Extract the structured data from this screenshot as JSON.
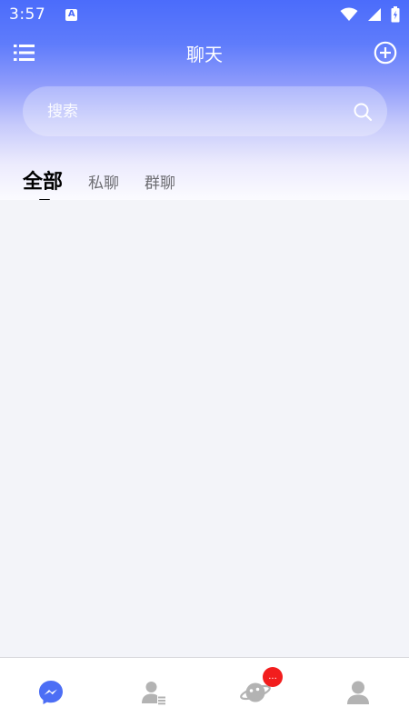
{
  "status_bar": {
    "time": "3:57",
    "app_icon_letter": "A"
  },
  "header": {
    "title": "聊天"
  },
  "search": {
    "placeholder": "搜索"
  },
  "tabs": [
    {
      "label": "全部",
      "active": true
    },
    {
      "label": "私聊",
      "active": false
    },
    {
      "label": "群聊",
      "active": false
    }
  ],
  "bottom_nav": {
    "items": [
      {
        "icon": "messenger-icon",
        "active": true
      },
      {
        "icon": "contacts-icon",
        "active": false
      },
      {
        "icon": "planet-icon",
        "active": false,
        "badge": "..."
      },
      {
        "icon": "profile-icon",
        "active": false
      }
    ]
  },
  "colors": {
    "primary": "#4b6cfb",
    "active_nav": "#4c6ef5",
    "inactive_nav": "#b3b3b3",
    "badge": "#f21d1d",
    "background": "#f3f4f9"
  }
}
